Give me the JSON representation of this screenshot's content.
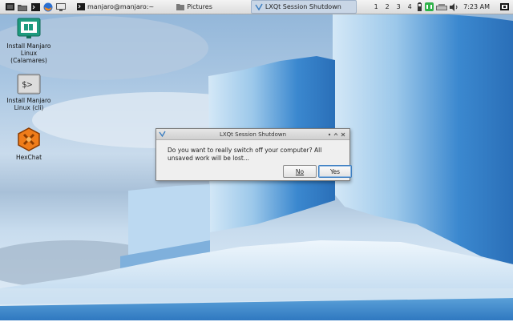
{
  "panel": {
    "tasks": [
      {
        "label": "manjaro@manjaro:~"
      },
      {
        "label": "Pictures"
      },
      {
        "label": "LXQt Session Shutdown",
        "active": true
      }
    ],
    "workspaces": [
      "1",
      "2",
      "3",
      "4"
    ],
    "clock": "7:23 AM"
  },
  "desktop_icons": [
    {
      "label": "Install Manjaro\nLinux\n(Calamares)",
      "icon": "installer-monitor-icon"
    },
    {
      "label": "Install Manjaro\nLinux (cli)",
      "icon": "terminal-icon",
      "glyph": "$>"
    },
    {
      "label": "HexChat",
      "icon": "hexchat-icon"
    }
  ],
  "dialog": {
    "title": "LXQt Session Shutdown",
    "message": "Do you want to really switch off your computer? All unsaved work will be lost...",
    "no_label": "No",
    "yes_label": "Yes"
  },
  "colors": {
    "accent": "#3d7fc1",
    "panel_bg": "#e6e6e6"
  }
}
